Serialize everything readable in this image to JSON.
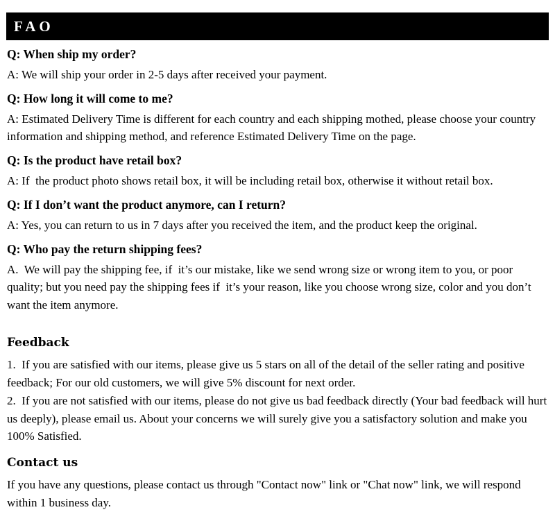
{
  "header": {
    "title": "FAO",
    "background_color": "#000000",
    "text_color": "#ffffff"
  },
  "faq": {
    "items": [
      {
        "question": "Q: When ship my order?",
        "answer": "A: We will ship your order in 2-5 days after received your payment."
      },
      {
        "question": "Q: How long it will come to me?",
        "answer": "A: Estimated Delivery Time is different for each country and each shipping mothed, please choose your country information and shipping method, and reference Estimated Delivery Time on the page."
      },
      {
        "question": "Q: Is the product have retail box?",
        "answer": "A: If  the product photo shows retail box, it will be including retail box, otherwise it without retail box."
      },
      {
        "question": "Q: If I don’t want the product anymore, can I return?",
        "answer": "A: Yes, you can return to us in 7 days after you received the item, and the product keep the original."
      },
      {
        "question": "Q: Who pay the return shipping fees?",
        "answer": "A.  We will pay the shipping fee, if  it’s our mistake, like we send wrong size or wrong item to you, or poor quality; but you need pay the shipping fees if  it’s your reason, like you choose wrong size, color and you don’t want the item anymore."
      }
    ]
  },
  "feedback": {
    "heading": "Feedback",
    "paragraphs": [
      "1.  If you are satisfied with our items, please give us 5 stars on all of the detail of the seller rating and positive feedback; For our old customers, we will give 5% discount for next order.",
      "2.  If you are not satisfied with our items, please do not give us bad feedback directly (Your bad feedback will hurt us deeply), please email us. About your concerns we will surely give you a satisfactory solution and make you 100% Satisfied."
    ]
  },
  "contact": {
    "heading": "Contact us",
    "paragraphs": [
      "If you have any questions, please contact us through \"Contact now\" link or \"Chat now\" link, we will respond within 1 business day."
    ]
  }
}
